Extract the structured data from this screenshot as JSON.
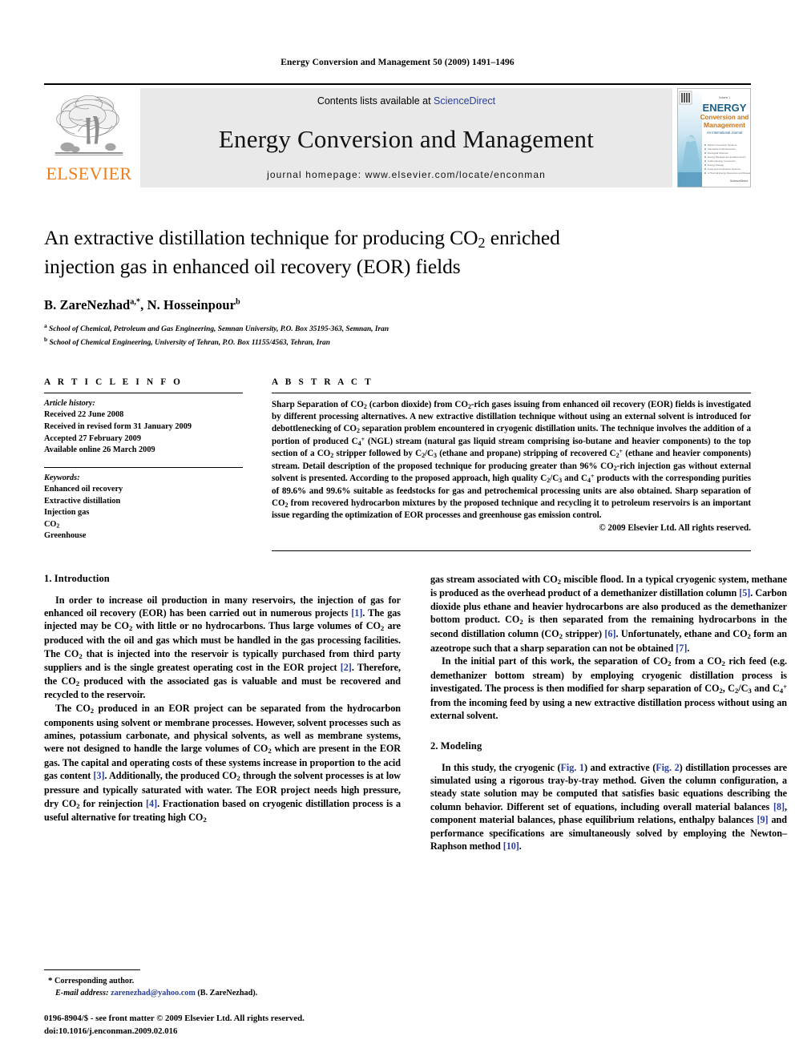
{
  "running_head": "Energy Conversion and Management 50 (2009) 1491–1496",
  "masthead": {
    "publisher_name": "ELSEVIER",
    "contents_prefix": "Contents lists available at ",
    "contents_link": "ScienceDirect",
    "journal_title": "Energy Conversion and Management",
    "homepage": "journal homepage: www.elsevier.com/locate/enconman",
    "cover": {
      "top_label": "Volume 1",
      "line1": "ENERGY",
      "line2": "Conversion and",
      "line3": "Management",
      "subtitle": "An International Journal",
      "bullets": [
        "Marine Conversion Systems",
        "Alternative Fuels Research",
        "Ecological Sciences",
        "Energy Management and Economics",
        "Carbon Energy Conversion",
        "Energy Storage",
        "Fuels and Combustion Systems",
        "A Thermal Energy Resources and Research"
      ],
      "footer": "ScienceDirect"
    }
  },
  "article": {
    "title_line1": "An extractive distillation technique for producing CO",
    "title_line1_sub": "2",
    "title_line1_tail": " enriched",
    "title_line2": "injection gas in enhanced oil recovery (EOR) fields",
    "authors": "B. ZareNezhad, N. Hosseinpour",
    "author1": "B. ZareNezhad",
    "author1_sup": "a,*",
    "author2": "N. Hosseinpour",
    "author2_sup": "b",
    "affiliation_a_sup": "a",
    "affiliation_a": "School of Chemical, Petroleum and Gas Engineering, Semnan University, P.O. Box 35195-363, Semnan, Iran",
    "affiliation_b_sup": "b",
    "affiliation_b": "School of Chemical Engineering, University of Tehran, P.O. Box 11155/4563, Tehran, Iran"
  },
  "article_info": {
    "heading": "A R T I C L E   I N F O",
    "history_heading": "Article history:",
    "history": [
      "Received 22 June 2008",
      "Received in revised form 31 January 2009",
      "Accepted 27 February 2009",
      "Available online 26 March 2009"
    ],
    "keywords_heading": "Keywords:",
    "keywords": [
      "Enhanced oil recovery",
      "Extractive distillation",
      "Injection gas",
      "CO2",
      "Greenhouse"
    ]
  },
  "abstract": {
    "heading": "A B S T R A C T",
    "text": "Sharp Separation of CO2 (carbon dioxide) from CO2-rich gases issuing from enhanced oil recovery (EOR) fields is investigated by different processing alternatives. A new extractive distillation technique without using an external solvent is introduced for debottlenecking of CO2 separation problem encountered in cryogenic distillation units. The technique involves the addition of a portion of produced C4+ (NGL) stream (natural gas liquid stream comprising iso-butane and heavier components) to the top section of a CO2 stripper followed by C2/C3 (ethane and propane) stripping of recovered C2+ (ethane and heavier components) stream. Detail description of the proposed technique for producing greater than 96% CO2-rich injection gas without external solvent is presented. According to the proposed approach, high quality C2/C3 and C4+ products with the corresponding purities of 89.6% and 99.6% suitable as feedstocks for gas and petrochemical processing units are also obtained. Sharp separation of CO2 from recovered hydrocarbon mixtures by the proposed technique and recycling it to petroleum reservoirs is an important issue regarding the optimization of EOR processes and greenhouse gas emission control.",
    "copyright": "© 2009 Elsevier Ltd. All rights reserved."
  },
  "sections": {
    "introduction_heading": "1. Introduction",
    "modeling_heading": "2. Modeling",
    "intro_p1": "In order to increase oil production in many reservoirs, the injection of gas for enhanced oil recovery (EOR) has been carried out in numerous projects [1]. The gas injected may be CO2 with little or no hydrocarbons. Thus large volumes of CO2 are produced with the oil and gas which must be handled in the gas processing facilities. The CO2 that is injected into the reservoir is typically purchased from third party suppliers and is the single greatest operating cost in the EOR project [2]. Therefore, the CO2 produced with the associated gas is valuable and must be recovered and recycled to the reservoir.",
    "intro_p2": "The CO2 produced in an EOR project can be separated from the hydrocarbon components using solvent or membrane processes. However, solvent processes such as amines, potassium carbonate, and physical solvents, as well as membrane systems, were not designed to handle the large volumes of CO2 which are present in the EOR gas. The capital and operating costs of these systems increase in proportion to the acid gas content [3]. Additionally, the produced CO2 through the solvent processes is at low pressure and typically saturated with water. The EOR project needs high pressure, dry CO2 for reinjection [4]. Fractionation based on cryogenic distillation process is a useful alternative for treating high CO2 gas stream associated with CO2 miscible flood. In a typical cryogenic system, methane is produced as the overhead product of a demethanizer distillation column [5]. Carbon dioxide plus ethane and heavier hydrocarbons are also produced as the demethanizer bottom product. CO2 is then separated from the remaining hydrocarbons in the second distillation column (CO2 stripper) [6]. Unfortunately, ethane and CO2 form an azeotrope such that a sharp separation can not be obtained [7].",
    "intro_p3": "In the initial part of this work, the separation of CO2 from a CO2 rich feed (e.g. demethanizer bottom stream) by employing cryogenic distillation process is investigated. The process is then modified for sharp separation of CO2, C2/C3 and C4+ from the incoming feed by using a new extractive distillation process without using an external solvent.",
    "modeling_p1": "In this study, the cryogenic (Fig. 1) and extractive (Fig. 2) distillation processes are simulated using a rigorous tray-by-tray method. Given the column configuration, a steady state solution may be computed that satisfies basic equations describing the column behavior. Different set of equations, including overall material balances [8], component material balances, phase equilibrium relations, enthalpy balances [9] and performance specifications are simultaneously solved by employing the Newton–Raphson method [10]."
  },
  "footnote": {
    "corresponding_marker": "*",
    "corresponding_text": "Corresponding author.",
    "email_label": "E-mail address:",
    "email": "zarenezhad@yahoo.com",
    "email_owner": "(B. ZareNezhad)."
  },
  "imprint": {
    "line1": "0196-8904/$ - see front matter © 2009 Elsevier Ltd. All rights reserved.",
    "line2": "doi:10.1016/j.enconman.2009.02.016"
  },
  "colors": {
    "link_blue": "#2b3f9c",
    "elsevier_orange": "#ef7d1a",
    "band_gray": "#e9e9e9"
  }
}
